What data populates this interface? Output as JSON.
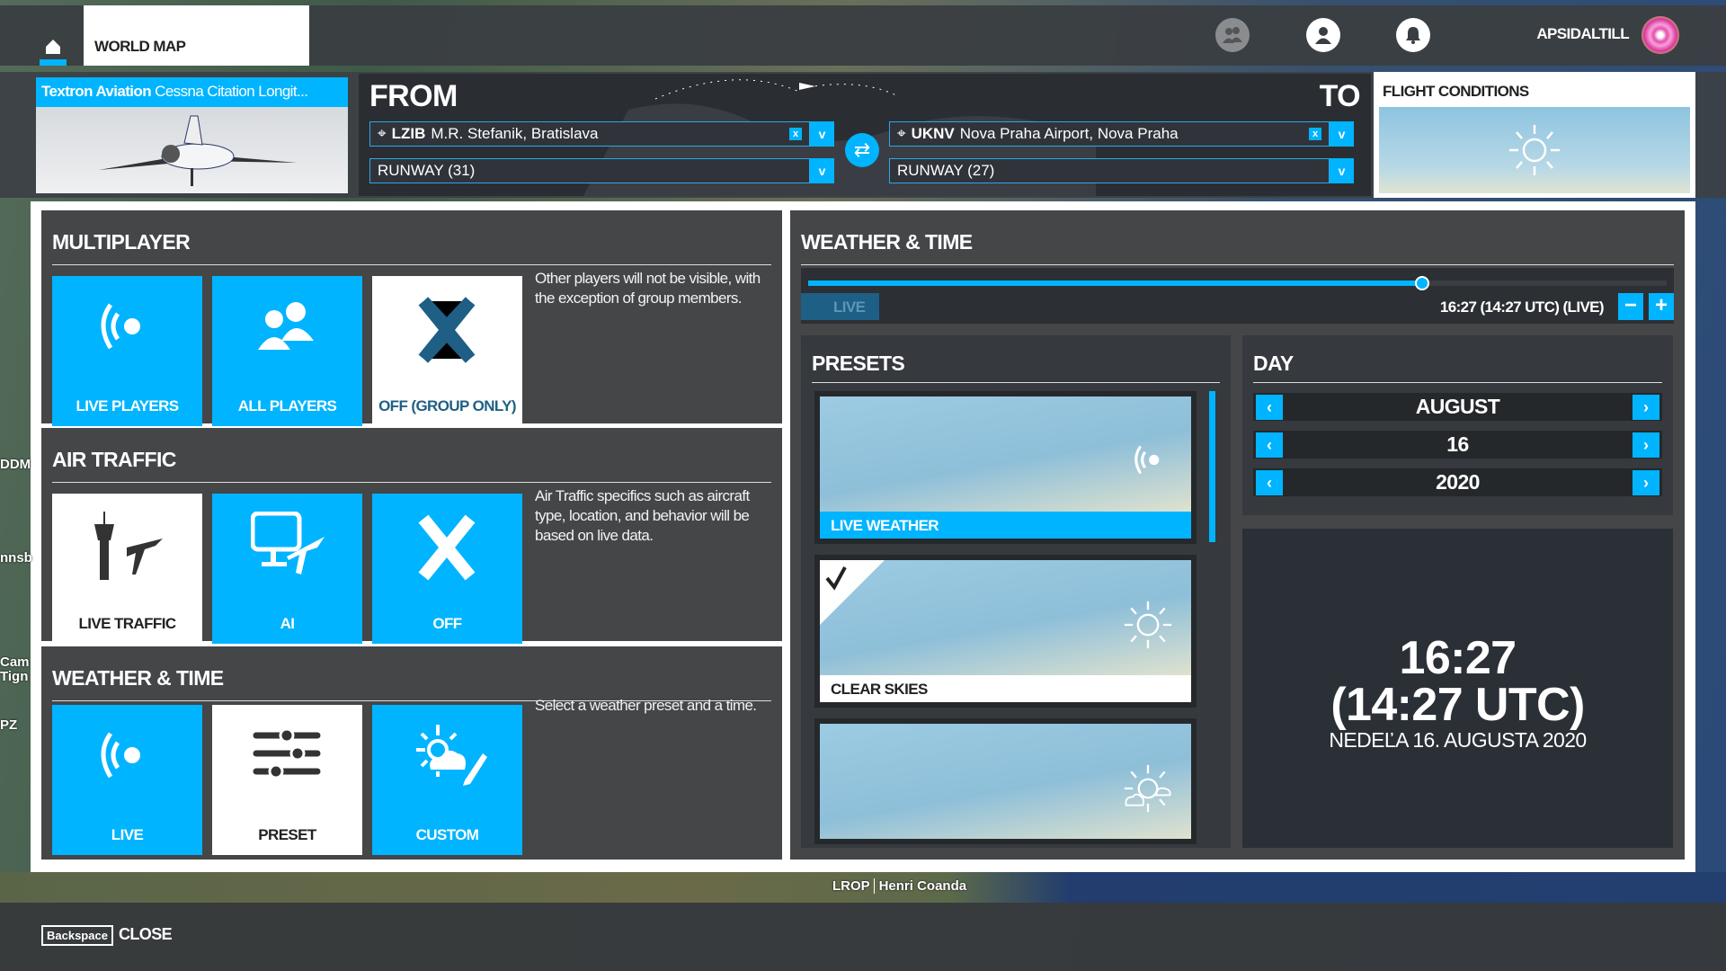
{
  "topbar": {
    "world_map": "WORLD MAP",
    "username": "APSIDALTILL",
    "icons": [
      "home-icon",
      "friends-icon",
      "profile-icon",
      "notification-bell-icon"
    ]
  },
  "aircraft": {
    "maker": "Textron Aviation",
    "model": "Cessna Citation Longit..."
  },
  "route": {
    "from_label": "FROM",
    "to_label": "TO",
    "from": {
      "icao": "LZIB",
      "name": "M.R. Stefanik, Bratislava",
      "runway": "RUNWAY (31)"
    },
    "to": {
      "icao": "UKNV",
      "name": "Nova Praha Airport, Nova Praha",
      "runway": "RUNWAY (27)"
    },
    "clear": "x",
    "dropdown": "v"
  },
  "flight_conditions": {
    "title": "FLIGHT CONDITIONS",
    "icon": "sun-icon"
  },
  "multiplayer": {
    "title": "MULTIPLAYER",
    "options": [
      "LIVE PLAYERS",
      "ALL PLAYERS",
      "OFF (GROUP ONLY)"
    ],
    "selected": "OFF (GROUP ONLY)",
    "description": "Other players will not be visible, with the exception of group members."
  },
  "air_traffic": {
    "title": "AIR TRAFFIC",
    "options": [
      "LIVE TRAFFIC",
      "AI",
      "OFF"
    ],
    "selected": "LIVE TRAFFIC",
    "description": "Air Traffic specifics such as aircraft type, location, and behavior will be based on live data."
  },
  "weather_time_left": {
    "title": "WEATHER & TIME",
    "options": [
      "LIVE",
      "PRESET",
      "CUSTOM"
    ],
    "selected": "PRESET",
    "description": "Select a weather preset and a time."
  },
  "weather_time": {
    "title": "WEATHER & TIME",
    "slider_percent": 71.5,
    "live_button": "LIVE",
    "time_display": "16:27 (14:27 UTC) (LIVE)",
    "minus": "−",
    "plus": "+",
    "presets": {
      "title": "PRESETS",
      "items": [
        {
          "label": "LIVE WEATHER",
          "icon": "live-signal-icon"
        },
        {
          "label": "CLEAR SKIES",
          "icon": "sun-icon",
          "selected": true
        },
        {
          "label": "",
          "icon": "partly-cloudy-icon"
        }
      ]
    },
    "day": {
      "title": "DAY",
      "month": "AUGUST",
      "day": "16",
      "year": "2020",
      "prev": "‹",
      "next": "›"
    },
    "clock": {
      "local": "16:27",
      "utc": "(14:27 UTC)",
      "date": "NEDEĽA 16. AUGUSTA 2020"
    }
  },
  "map": {
    "airport_icao": "LROP",
    "airport_name": "Henri Coanda",
    "edge_labels": [
      "DDM",
      "nnsb",
      "Cam",
      "Tign",
      "PZ"
    ]
  },
  "footer": {
    "key": "Backspace",
    "close": "CLOSE"
  },
  "colors": {
    "accent": "#00b4ff",
    "panel": "#3e4042",
    "selected_tile": "#ffffff"
  }
}
